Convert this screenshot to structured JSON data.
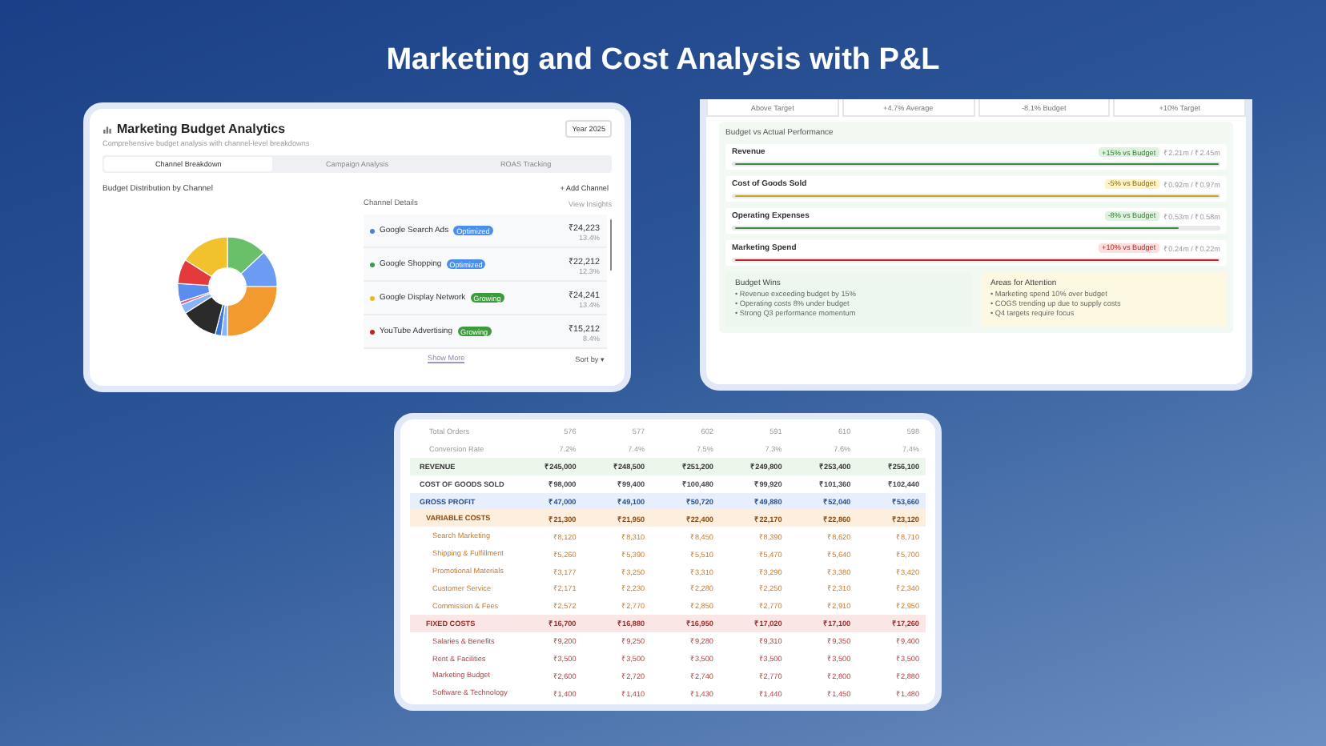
{
  "heading": "Marketing and Cost Analysis with P&L",
  "budget_analytics": {
    "title": "Marketing Budget Analytics",
    "subtitle": "Comprehensive budget analysis with channel-level breakdowns",
    "period_button": "Year 2025",
    "tabs": [
      {
        "label": "Channel Breakdown",
        "selected": true
      },
      {
        "label": "Campaign Analysis",
        "selected": false
      },
      {
        "label": "ROAS Tracking",
        "selected": false
      }
    ],
    "section_title": "Budget Distribution by Channel",
    "add_button": "+ Add Channel",
    "details_title": "Channel Details",
    "details_link": "View Insights",
    "channels": [
      {
        "name": "Google Search Ads",
        "color": "#4a7fe0",
        "tag": {
          "text": "Optimized",
          "kind": "info"
        },
        "amount": "₹24,223",
        "share": "13.4%"
      },
      {
        "name": "Google Shopping",
        "color": "#3e9b4f",
        "tag": {
          "text": "Optimized",
          "kind": "info"
        },
        "amount": "₹22,212",
        "share": "12.3%"
      },
      {
        "name": "Google Display Network",
        "color": "#e8b923",
        "tag": {
          "text": "Growing",
          "kind": "success"
        },
        "amount": "₹24,241",
        "share": "13.4%"
      },
      {
        "name": "YouTube Advertising",
        "color": "#c81e1e",
        "tag": {
          "text": "Growing",
          "kind": "success"
        },
        "amount": "₹15,212",
        "share": "8.4%"
      }
    ],
    "show_more": "Show More",
    "sort": "Sort by ▾"
  },
  "performance": {
    "stats": [
      "Above Target",
      "+4.7% Average",
      "-8.1% Budget",
      "+10% Target"
    ],
    "title": "Budget vs Actual Performance",
    "rows": [
      {
        "label": "Revenue",
        "badge": "+15% vs Budget",
        "kind": "positive",
        "reading": "₹2.21m / ₹2.45m",
        "level": 1.0
      },
      {
        "label": "Cost of Goods Sold",
        "badge": "-5% vs Budget",
        "kind": "warning",
        "reading": "₹0.92m / ₹0.97m",
        "level": 1.0
      },
      {
        "label": "Operating Expenses",
        "badge": "-8% vs Budget",
        "kind": "positive",
        "reading": "₹0.53m / ₹0.58m",
        "level": 0.92
      },
      {
        "label": "Marketing Spend",
        "badge": "+10% vs Budget",
        "kind": "negative",
        "reading": "₹0.24m / ₹0.22m",
        "level": 1.0
      }
    ],
    "wins": {
      "title": "Budget Wins",
      "items": [
        "• Revenue exceeding budget by 15%",
        "• Operating costs 8% under budget",
        "• Strong Q3 performance momentum"
      ]
    },
    "attention": {
      "title": "Areas for Attention",
      "items": [
        "• Marketing spend 10% over budget",
        "• COGS trending up due to supply costs",
        "• Q4 targets require focus"
      ]
    }
  },
  "pnl": {
    "rows": [
      {
        "kind": "metric",
        "label": "Total Orders",
        "values": [
          "576",
          "577",
          "602",
          "591",
          "610",
          "598"
        ]
      },
      {
        "kind": "metric",
        "label": "Conversion Rate",
        "values": [
          "7.2%",
          "7.4%",
          "7.5%",
          "7.3%",
          "7.6%",
          "7.4%"
        ]
      },
      {
        "kind": "revenue",
        "label": "REVENUE",
        "values": [
          "₹245,000",
          "₹248,500",
          "₹251,200",
          "₹249,800",
          "₹253,400",
          "₹256,100"
        ]
      },
      {
        "kind": "cogs",
        "label": "COST OF GOODS SOLD",
        "values": [
          "₹98,000",
          "₹99,400",
          "₹100,480",
          "₹99,920",
          "₹101,360",
          "₹102,440"
        ]
      },
      {
        "kind": "gross",
        "label": "GROSS PROFIT",
        "values": [
          "₹47,000",
          "₹49,100",
          "₹50,720",
          "₹49,880",
          "₹52,040",
          "₹53,660"
        ]
      },
      {
        "kind": "variable",
        "label": "VARIABLE COSTS",
        "values": [
          "₹21,300",
          "₹21,950",
          "₹22,400",
          "₹22,170",
          "₹22,860",
          "₹23,120"
        ]
      },
      {
        "kind": "variable-item",
        "label": "Search Marketing",
        "values": [
          "₹8,120",
          "₹8,310",
          "₹8,450",
          "₹8,390",
          "₹8,620",
          "₹8,710"
        ]
      },
      {
        "kind": "variable-item",
        "label": "Shipping & Fulfillment",
        "values": [
          "₹5,260",
          "₹5,390",
          "₹5,510",
          "₹5,470",
          "₹5,640",
          "₹5,700"
        ]
      },
      {
        "kind": "variable-item",
        "label": "Promotional Materials",
        "values": [
          "₹3,177",
          "₹3,250",
          "₹3,310",
          "₹3,290",
          "₹3,380",
          "₹3,420"
        ]
      },
      {
        "kind": "variable-item",
        "label": "Customer Service",
        "values": [
          "₹2,171",
          "₹2,230",
          "₹2,280",
          "₹2,250",
          "₹2,310",
          "₹2,340"
        ]
      },
      {
        "kind": "variable-item",
        "label": "Commission & Fees",
        "values": [
          "₹2,572",
          "₹2,770",
          "₹2,850",
          "₹2,770",
          "₹2,910",
          "₹2,950"
        ]
      },
      {
        "kind": "fixed",
        "label": "FIXED COSTS",
        "values": [
          "₹16,700",
          "₹16,880",
          "₹16,950",
          "₹17,020",
          "₹17,100",
          "₹17,260"
        ]
      },
      {
        "kind": "fixed-item",
        "label": "Salaries & Benefits",
        "values": [
          "₹9,200",
          "₹9,250",
          "₹9,280",
          "₹9,310",
          "₹9,350",
          "₹9,400"
        ]
      },
      {
        "kind": "fixed-item",
        "label": "Rent & Facilities",
        "values": [
          "₹3,500",
          "₹3,500",
          "₹3,500",
          "₹3,500",
          "₹3,500",
          "₹3,500"
        ]
      },
      {
        "kind": "fixed-item",
        "label": "Marketing Budget",
        "values": [
          "₹2,600",
          "₹2,720",
          "₹2,740",
          "₹2,770",
          "₹2,800",
          "₹2,880"
        ]
      },
      {
        "kind": "fixed-item",
        "label": "Software & Technology",
        "values": [
          "₹1,400",
          "₹1,410",
          "₹1,430",
          "₹1,440",
          "₹1,450",
          "₹1,480"
        ]
      }
    ]
  }
}
